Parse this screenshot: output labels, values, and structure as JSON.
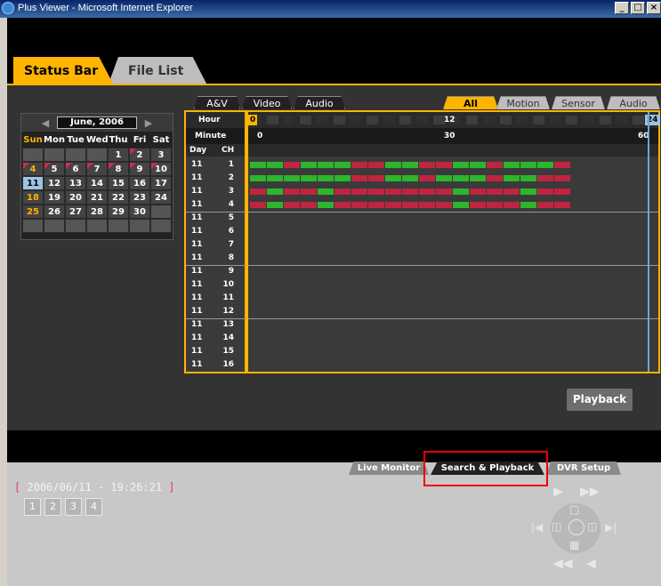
{
  "window": {
    "title": "Plus Viewer - Microsoft Internet Explorer"
  },
  "main_tabs": [
    {
      "label": "Status Bar",
      "active": true
    },
    {
      "label": "File List",
      "active": false
    }
  ],
  "calendar": {
    "month_label": "June, 2006",
    "weekday_headers": [
      "Sun",
      "Mon",
      "Tue",
      "Wed",
      "Thu",
      "Fri",
      "Sat"
    ],
    "days": [
      "",
      "",
      "",
      "",
      "1",
      "2",
      "3",
      "4",
      "5",
      "6",
      "7",
      "8",
      "9",
      "10",
      "11",
      "12",
      "13",
      "14",
      "15",
      "16",
      "17",
      "18",
      "19",
      "20",
      "21",
      "22",
      "23",
      "24",
      "25",
      "26",
      "27",
      "28",
      "29",
      "30",
      "",
      "",
      "",
      "",
      "",
      "",
      "",
      ""
    ],
    "recorded_days": [
      "2",
      "4",
      "5",
      "6",
      "7",
      "8",
      "9",
      "10"
    ],
    "selected_day": "11"
  },
  "left_filter_tabs": [
    "A&V",
    "Video",
    "Audio"
  ],
  "right_filter_tabs": [
    "All",
    "Motion",
    "Sensor",
    "Audio"
  ],
  "active_right_filter": "All",
  "timeline": {
    "hour_label": "Hour",
    "minute_label": "Minute",
    "day_header": "Day",
    "ch_header": "CH",
    "hour_marks": [
      "0",
      "12",
      "24"
    ],
    "minute_marks": [
      "0",
      "30",
      "60"
    ],
    "rows": [
      {
        "day": "11",
        "ch": "1"
      },
      {
        "day": "11",
        "ch": "2"
      },
      {
        "day": "11",
        "ch": "3"
      },
      {
        "day": "11",
        "ch": "4"
      },
      {
        "day": "11",
        "ch": "5"
      },
      {
        "day": "11",
        "ch": "6"
      },
      {
        "day": "11",
        "ch": "7"
      },
      {
        "day": "11",
        "ch": "8"
      },
      {
        "day": "11",
        "ch": "9"
      },
      {
        "day": "11",
        "ch": "10"
      },
      {
        "day": "11",
        "ch": "11"
      },
      {
        "day": "11",
        "ch": "12"
      },
      {
        "day": "11",
        "ch": "13"
      },
      {
        "day": "11",
        "ch": "14"
      },
      {
        "day": "11",
        "ch": "15"
      },
      {
        "day": "11",
        "ch": "16"
      }
    ],
    "colors": {
      "motion": "#2db52d",
      "continuous": "#c0253f"
    },
    "records": [
      [
        "g",
        "g",
        "r",
        "g",
        "g",
        "g",
        "r",
        "r",
        "g",
        "g",
        "r",
        "r",
        "g",
        "g",
        "r",
        "g",
        "g",
        "g",
        "r"
      ],
      [
        "g",
        "g",
        "g",
        "g",
        "g",
        "g",
        "r",
        "r",
        "g",
        "g",
        "r",
        "g",
        "g",
        "g",
        "r",
        "g",
        "g",
        "r",
        "r"
      ],
      [
        "r",
        "g",
        "r",
        "r",
        "g",
        "r",
        "r",
        "r",
        "r",
        "r",
        "r",
        "r",
        "g",
        "r",
        "r",
        "r",
        "g",
        "r",
        "r"
      ],
      [
        "r",
        "g",
        "r",
        "r",
        "g",
        "r",
        "r",
        "r",
        "r",
        "r",
        "r",
        "r",
        "g",
        "r",
        "r",
        "r",
        "g",
        "r",
        "r"
      ]
    ]
  },
  "playback_button": "Playback",
  "bottom_tabs": [
    {
      "label": "Live Monitor",
      "active": false
    },
    {
      "label": "Search & Playback",
      "active": true
    },
    {
      "label": "DVR Setup",
      "active": false
    }
  ],
  "status": {
    "datetime": "2006/06/11 - 19:26:21",
    "bracket_open": "[",
    "bracket_close": "]"
  },
  "channel_buttons": [
    "1",
    "2",
    "3",
    "4"
  ]
}
